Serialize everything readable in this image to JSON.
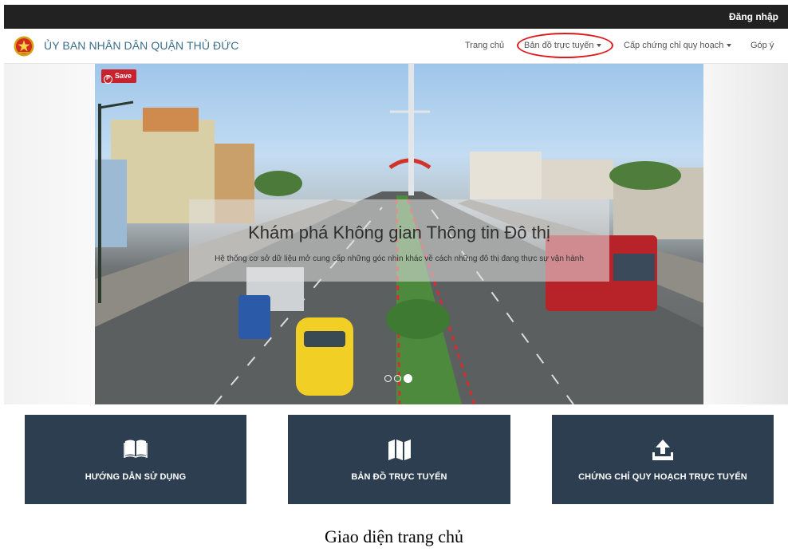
{
  "topbar": {
    "login_label": "Đăng nhập"
  },
  "navbar": {
    "brand_title": "ỦY BAN NHÂN DÂN QUẬN THỦ ĐỨC",
    "brand_logo_icon": "national-emblem-icon",
    "items": [
      {
        "label": "Trang chủ",
        "has_dropdown": false
      },
      {
        "label": "Bản đồ trực tuyến",
        "has_dropdown": true,
        "highlighted": true
      },
      {
        "label": "Cấp chứng chỉ quy hoạch",
        "has_dropdown": true
      },
      {
        "label": "Góp ý",
        "has_dropdown": false
      }
    ],
    "highlight_color": "#e0191c"
  },
  "hero": {
    "save_label": "Save",
    "title": "Khám phá Không gian Thông tin Đô thị",
    "subtitle": "Hệ thống cơ sở dữ liệu mở cung cấp những góc nhìn khác về cách những đô thị đang thực sự vận hành",
    "slides_total": 3,
    "active_slide": 3,
    "pin_color": "#c8232c"
  },
  "tiles": [
    {
      "label": "HƯỚNG DẪN SỬ DỤNG",
      "icon": "open-book-icon"
    },
    {
      "label": "BẢN ĐỒ TRỰC TUYẾN",
      "icon": "folded-map-icon"
    },
    {
      "label": "CHỨNG CHỈ QUY HOẠCH TRỰC TUYẾN",
      "icon": "upload-tray-icon"
    }
  ],
  "theme": {
    "topbar_bg": "#222222",
    "brand_color": "#3d6e8a",
    "tile_bg": "#2c3e50"
  },
  "figure_caption": "Giao diện trang chủ"
}
